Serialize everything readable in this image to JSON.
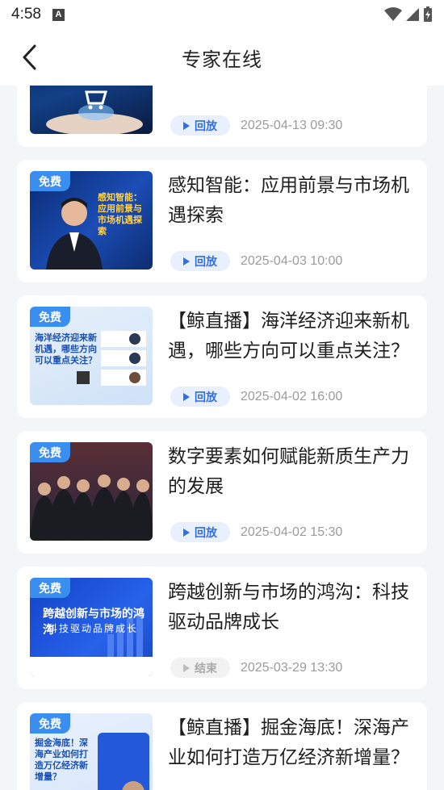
{
  "status_bar": {
    "time": "4:58",
    "notification_icon_letter": "A"
  },
  "header": {
    "title": "专家在线"
  },
  "colors": {
    "accent": "#2f6fe0",
    "free_tag": "#3a8ef0",
    "ended_badge": "#a9a9a9"
  },
  "items": [
    {
      "title": "",
      "status": "回放",
      "time": "2025-04-13 09:30",
      "free_label": ""
    },
    {
      "title": "感知智能：应用前景与市场机遇探索",
      "status": "回放",
      "time": "2025-04-03 10:00",
      "free_label": "免费",
      "thumb_text": "感知智能：应用前景与市场机遇探索"
    },
    {
      "title": "【鲸直播】海洋经济迎来新机遇，哪些方向可以重点关注？",
      "status": "回放",
      "time": "2025-04-02 16:00",
      "free_label": "免费",
      "thumb_text": "海洋经济迎来新机遇，哪些方向可以重点关注？"
    },
    {
      "title": "数字要素如何赋能新质生产力的发展",
      "status": "回放",
      "time": "2025-04-02 15:30",
      "free_label": "免费"
    },
    {
      "title": "跨越创新与市场的鸿沟：科技驱动品牌成长",
      "status": "结束",
      "time": "2025-03-29 13:30",
      "free_label": "免费",
      "thumb_text": "跨越创新与市场的鸿沟",
      "thumb_sub": "科技驱动品牌成长"
    },
    {
      "title": "【鲸直播】掘金海底！深海产业如何打造万亿经济新增量？",
      "status": "",
      "time": "",
      "free_label": "免费",
      "thumb_text": "掘金海底！深海产业如何打造万亿经济新增量？"
    }
  ]
}
